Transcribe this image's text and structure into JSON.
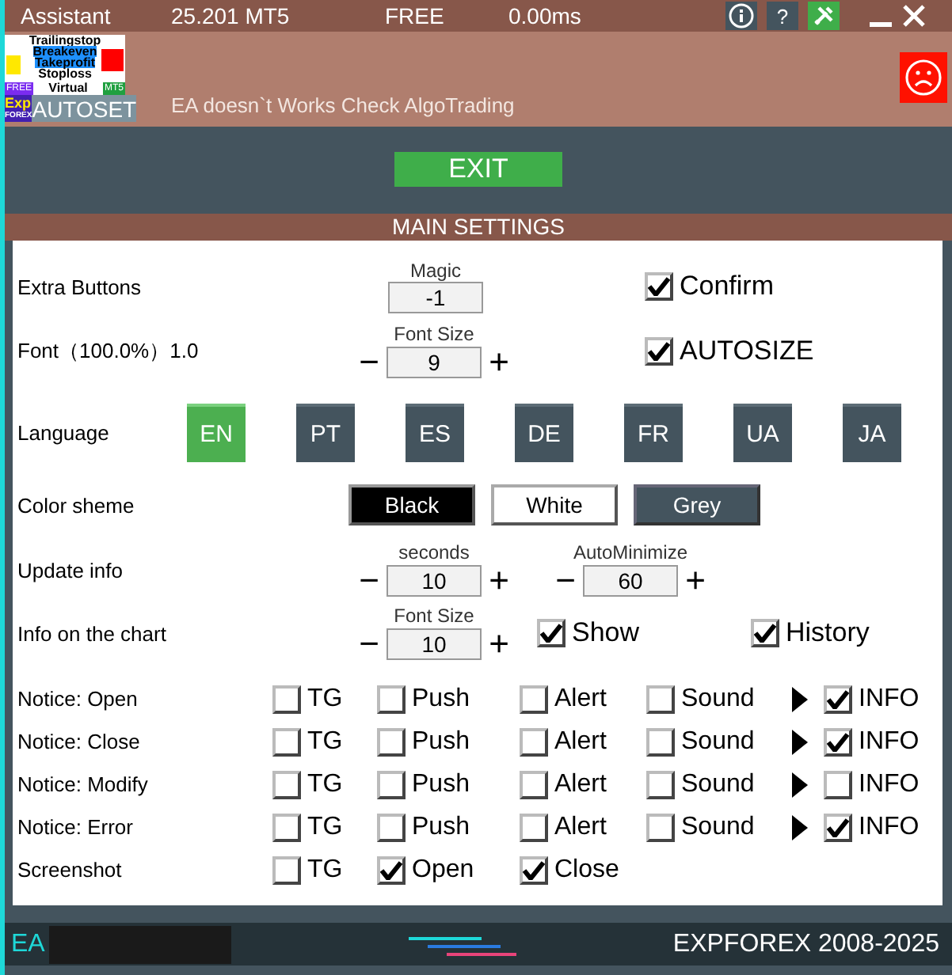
{
  "header": {
    "title": "Assistant",
    "version": "25.201 MT5",
    "license": "FREE",
    "ping": "0.00ms",
    "help": "?"
  },
  "logo": {
    "lines": [
      "Trailingstop",
      "Breakeven",
      "Takeprofit",
      "Stoploss"
    ],
    "free": "FREE",
    "virtual": "Virtual",
    "mt": "MT5",
    "brand_top": "Exp",
    "brand_bottom": "FOREX",
    "autoset": "AUTOSET"
  },
  "status_message": "EA doesn`t Works Check AlgoTrading",
  "exit_button": "EXIT",
  "section_title": "MAIN SETTINGS",
  "extra_buttons": {
    "label": "Extra Buttons",
    "caption": "Magic",
    "value": "-1",
    "check": {
      "label": "Confirm",
      "checked": true
    }
  },
  "font": {
    "label": "Font（100.0%）1.0",
    "stepper": {
      "caption": "Font Size",
      "value": "9",
      "minus": "−",
      "plus": "+"
    },
    "check": {
      "label": "AUTOSIZE",
      "checked": true
    }
  },
  "language": {
    "label": "Language",
    "options": [
      {
        "label": "EN",
        "selected": true
      },
      {
        "label": "PT",
        "selected": false
      },
      {
        "label": "ES",
        "selected": false
      },
      {
        "label": "DE",
        "selected": false
      },
      {
        "label": "FR",
        "selected": false
      },
      {
        "label": "UA",
        "selected": false
      },
      {
        "label": "JA",
        "selected": false
      }
    ]
  },
  "color_scheme": {
    "label": "Color sheme",
    "options": [
      {
        "label": "Black",
        "kind": "black"
      },
      {
        "label": "White",
        "kind": "white"
      },
      {
        "label": "Grey",
        "kind": "grey"
      }
    ]
  },
  "update_info": {
    "label": "Update info",
    "steppers": [
      {
        "caption": "seconds",
        "value": "10",
        "minus": "−",
        "plus": "+"
      },
      {
        "caption": "AutoMinimize",
        "value": "60",
        "minus": "−",
        "plus": "+"
      }
    ]
  },
  "info_chart": {
    "label": "Info on the chart",
    "stepper": {
      "caption": "Font Size",
      "value": "10",
      "minus": "−",
      "plus": "+"
    },
    "checks": [
      {
        "label": "Show",
        "checked": true
      },
      {
        "label": "History",
        "checked": true
      }
    ]
  },
  "notices": [
    {
      "label": "Notice: Open",
      "options": [
        {
          "label": "TG",
          "checked": false
        },
        {
          "label": "Push",
          "checked": false
        },
        {
          "label": "Alert",
          "checked": false
        },
        {
          "label": "Sound",
          "checked": false
        }
      ],
      "info": {
        "label": "INFO",
        "checked": true
      }
    },
    {
      "label": "Notice: Close",
      "options": [
        {
          "label": "TG",
          "checked": false
        },
        {
          "label": "Push",
          "checked": false
        },
        {
          "label": "Alert",
          "checked": false
        },
        {
          "label": "Sound",
          "checked": false
        }
      ],
      "info": {
        "label": "INFO",
        "checked": true
      }
    },
    {
      "label": "Notice: Modify",
      "options": [
        {
          "label": "TG",
          "checked": false
        },
        {
          "label": "Push",
          "checked": false
        },
        {
          "label": "Alert",
          "checked": false
        },
        {
          "label": "Sound",
          "checked": false
        }
      ],
      "info": {
        "label": "INFO",
        "checked": false
      }
    },
    {
      "label": "Notice: Error",
      "options": [
        {
          "label": "TG",
          "checked": false
        },
        {
          "label": "Push",
          "checked": false
        },
        {
          "label": "Alert",
          "checked": false
        },
        {
          "label": "Sound",
          "checked": false
        }
      ],
      "info": {
        "label": "INFO",
        "checked": true
      }
    }
  ],
  "screenshot": {
    "label": "Screenshot",
    "options": [
      {
        "label": "TG",
        "checked": false
      },
      {
        "label": "Open",
        "checked": true
      },
      {
        "label": "Close",
        "checked": true
      }
    ]
  },
  "footer": {
    "left": "EA",
    "right": "EXPFOREX 2008-2025"
  }
}
